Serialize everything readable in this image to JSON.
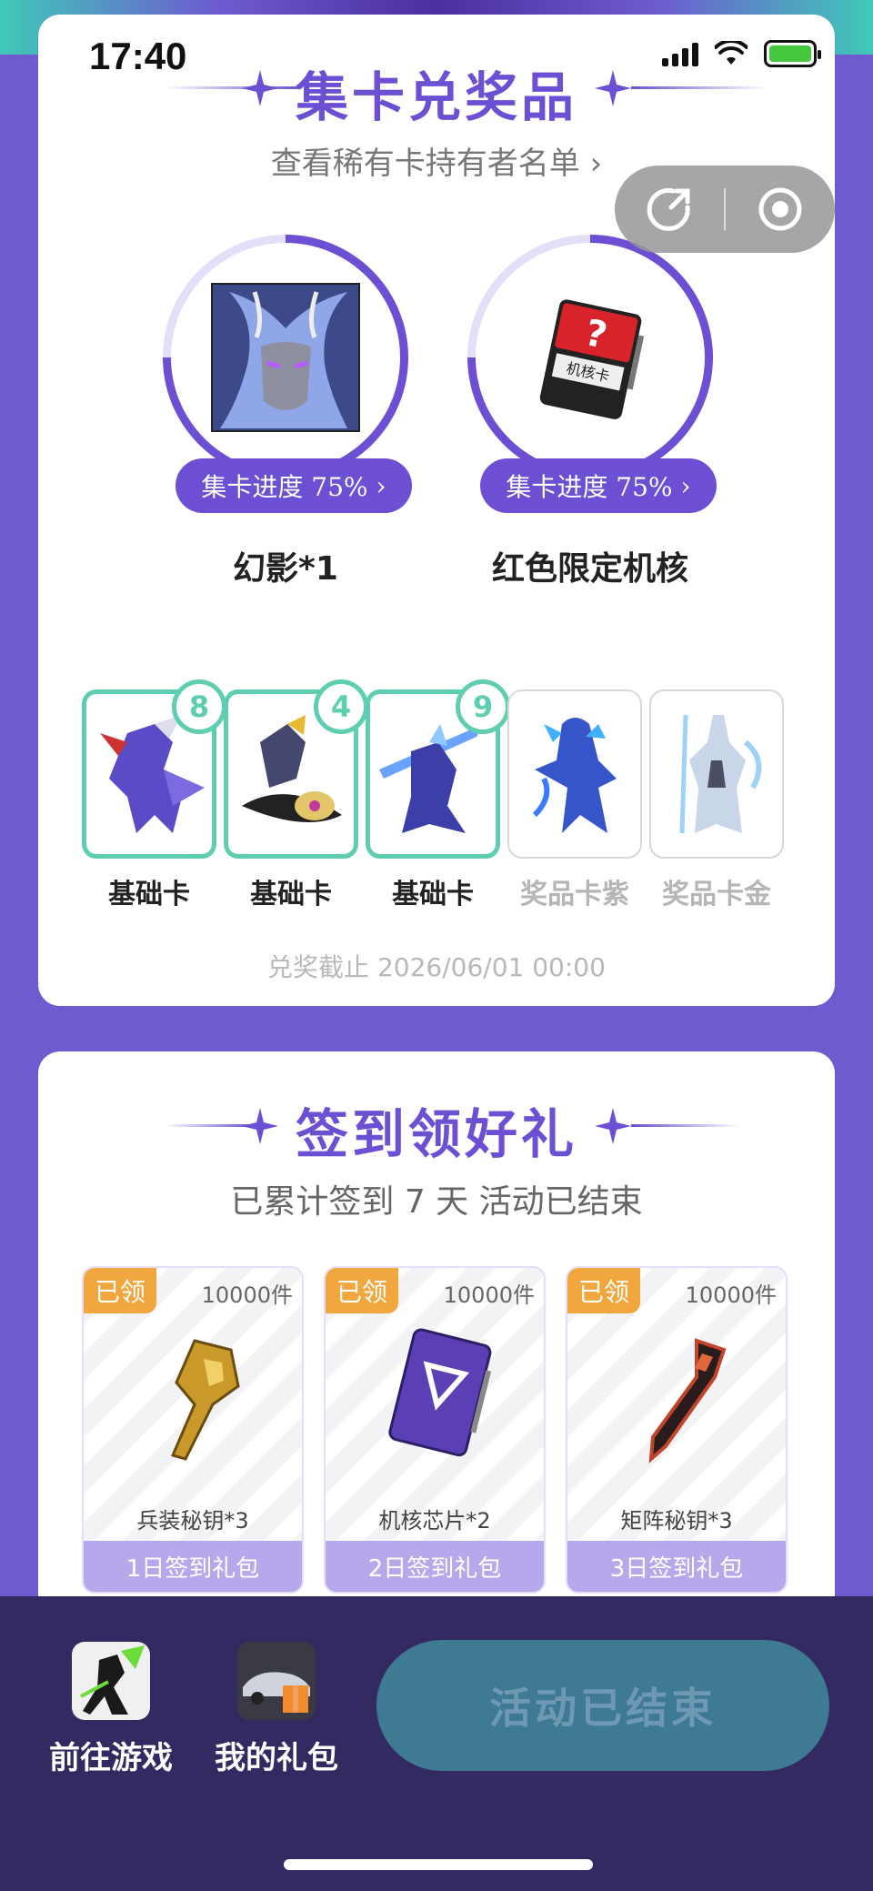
{
  "status_bar": {
    "time": "17:40"
  },
  "collect": {
    "title": "集卡兑奖品",
    "holders_link": "查看稀有卡持有者名单 ",
    "prizes": [
      {
        "name": "幻影*1",
        "progress_label": "集卡进度 75%",
        "progress": 0.75
      },
      {
        "name": "红色限定机核",
        "progress_label": "集卡进度 75%",
        "progress": 0.75,
        "card_text": "机核卡"
      }
    ],
    "cards": [
      {
        "label": "基础卡",
        "count": "8",
        "owned": true
      },
      {
        "label": "基础卡",
        "count": "4",
        "owned": true
      },
      {
        "label": "基础卡",
        "count": "9",
        "owned": true
      },
      {
        "label": "奖品卡紫",
        "owned": false
      },
      {
        "label": "奖品卡金",
        "owned": false
      }
    ],
    "deadline": "兑奖截止 2026/06/01 00:00"
  },
  "signin": {
    "title": "签到领好礼",
    "summary": "已累计签到 7 天  活动已结束",
    "gifts": [
      {
        "tag": "已领",
        "stock": "10000件",
        "name": "兵装秘钥*3",
        "day": "1日签到礼包"
      },
      {
        "tag": "已领",
        "stock": "10000件",
        "name": "机核芯片*2",
        "day": "2日签到礼包"
      },
      {
        "tag": "已领",
        "stock": "10000件",
        "name": "矩阵秘钥*3",
        "day": "3日签到礼包"
      }
    ]
  },
  "bottom": {
    "go_game": "前往游戏",
    "my_gifts": "我的礼包",
    "action_button": "活动已结束"
  },
  "colors": {
    "accent": "#6c4fd2",
    "owned_border": "#5ecdb0",
    "claimed_tag": "#f1a73d",
    "bottom_bar": "#332a62",
    "ended_button": "#3e7a92"
  }
}
